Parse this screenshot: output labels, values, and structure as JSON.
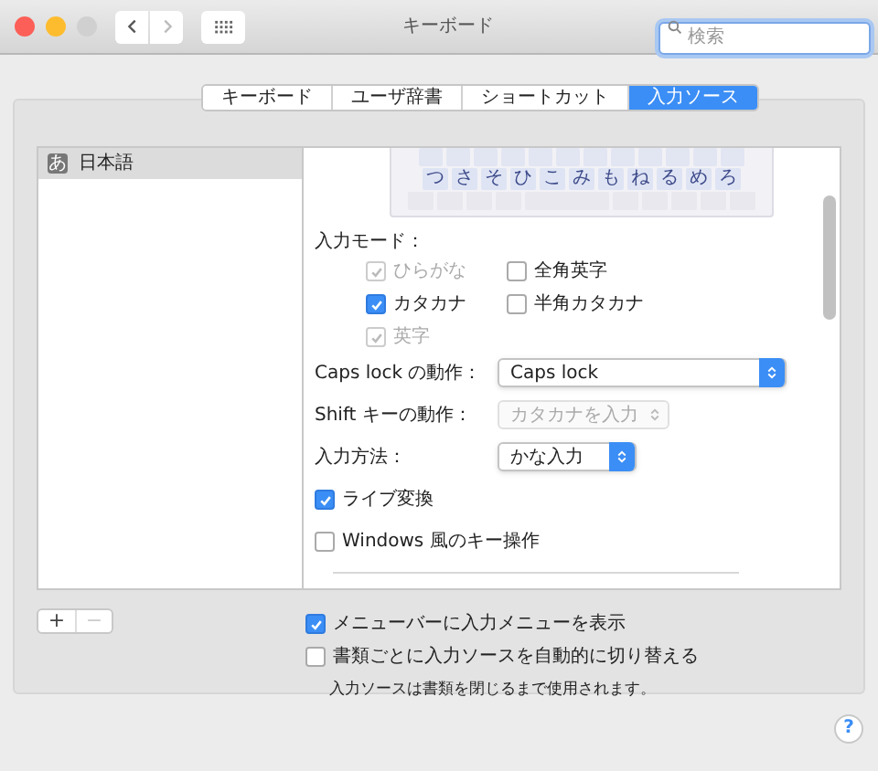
{
  "window": {
    "title": "キーボード",
    "search": {
      "placeholder": "検索"
    }
  },
  "tabs": [
    {
      "label": "キーボード",
      "selected": false
    },
    {
      "label": "ユーザ辞書",
      "selected": false
    },
    {
      "label": "ショートカット",
      "selected": false
    },
    {
      "label": "入力ソース",
      "selected": true
    }
  ],
  "sources": [
    {
      "icon": "あ",
      "label": "日本語",
      "selected": true
    }
  ],
  "keyboard_preview": {
    "row_2": [
      "つ",
      "さ",
      "そ",
      "ひ",
      "こ",
      "み",
      "も",
      "ね",
      "る",
      "め",
      "ろ"
    ]
  },
  "input_modes": {
    "label": "入力モード：",
    "options": [
      {
        "label": "ひらがな",
        "checked": true,
        "disabled": true
      },
      {
        "label": "全角英字",
        "checked": false,
        "disabled": false
      },
      {
        "label": "カタカナ",
        "checked": true,
        "disabled": false
      },
      {
        "label": "半角カタカナ",
        "checked": false,
        "disabled": false
      },
      {
        "label": "英字",
        "checked": true,
        "disabled": true
      }
    ]
  },
  "settings": [
    {
      "label": "Caps lock の動作：",
      "value": "Caps lock",
      "disabled": false
    },
    {
      "label": "Shift キーの動作：",
      "value": "カタカナを入力",
      "disabled": true
    },
    {
      "label": "入力方法：",
      "value": "かな入力",
      "disabled": false
    }
  ],
  "options": [
    {
      "label": "ライブ変換",
      "checked": true
    },
    {
      "label": "Windows 風のキー操作",
      "checked": false
    }
  ],
  "list_buttons": [
    "+",
    "−"
  ],
  "footer_options": [
    {
      "label": "メニューバーに入力メニューを表示",
      "checked": true
    },
    {
      "label": "書類ごとに入力ソースを自動的に切り替える",
      "checked": false
    }
  ],
  "footer_note": "入力ソースは書類を閉じるまで使用されます。",
  "help": "?"
}
